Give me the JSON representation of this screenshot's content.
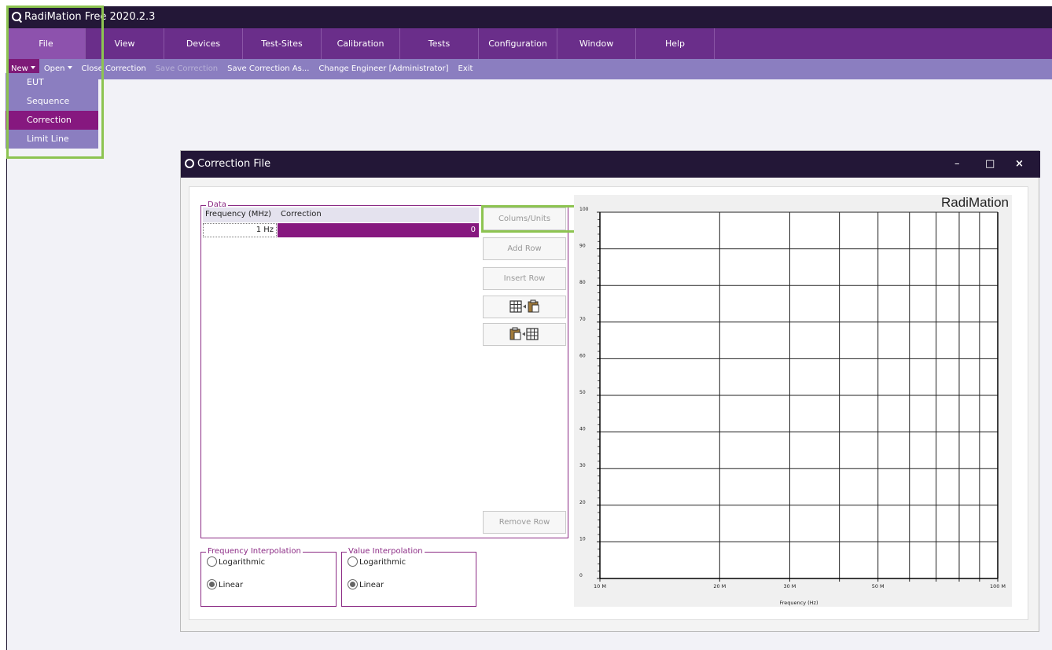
{
  "app": {
    "title": "RadiMation Free 2020.2.3"
  },
  "menu": [
    "File",
    "View",
    "Devices",
    "Test-Sites",
    "Calibration",
    "Tests",
    "Configuration",
    "Window",
    "Help"
  ],
  "toolbar": {
    "new": "New",
    "open": "Open",
    "close": "Close Correction",
    "save": "Save Correction",
    "save_as": "Save Correction As...",
    "engineer": "Change Engineer [Administrator]",
    "exit": "Exit"
  },
  "new_menu": [
    "EUT",
    "Sequence",
    "Correction",
    "Limit Line"
  ],
  "dialog": {
    "title": "Correction File",
    "min": "–",
    "max": "□",
    "close": "×"
  },
  "data_group": {
    "legend": "Data",
    "columns": [
      "Frequency (MHz)",
      "Correction"
    ],
    "rows": [
      {
        "frequency": "1 Hz",
        "correction": "0"
      }
    ]
  },
  "buttons": {
    "columns_units": "Colums/Units",
    "add_row": "Add Row",
    "insert_row": "Insert Row",
    "remove_row": "Remove Row"
  },
  "freq_interp": {
    "legend": "Frequency Interpolation",
    "opt1": "Logarithmic",
    "opt2": "Linear",
    "selected": "Linear"
  },
  "value_interp": {
    "legend": "Value Interpolation",
    "opt1": "Logarithmic",
    "opt2": "Linear",
    "selected": "Linear"
  },
  "chart_data": {
    "type": "line",
    "brand": "RadiMation",
    "xlabel": "Frequency (Hz)",
    "ylabel": "",
    "xscale": "log",
    "xlim": [
      10000000,
      100000000
    ],
    "ylim": [
      0,
      100
    ],
    "x_ticks": [
      {
        "value": 10000000,
        "label": "10 M"
      },
      {
        "value": 20000000,
        "label": "20 M"
      },
      {
        "value": 30000000,
        "label": "30 M"
      },
      {
        "value": 50000000,
        "label": "50 M"
      },
      {
        "value": 100000000,
        "label": "100 M"
      }
    ],
    "y_ticks": [
      "0",
      "10",
      "20",
      "30",
      "40",
      "50",
      "60",
      "70",
      "80",
      "90",
      "100"
    ],
    "series": []
  }
}
